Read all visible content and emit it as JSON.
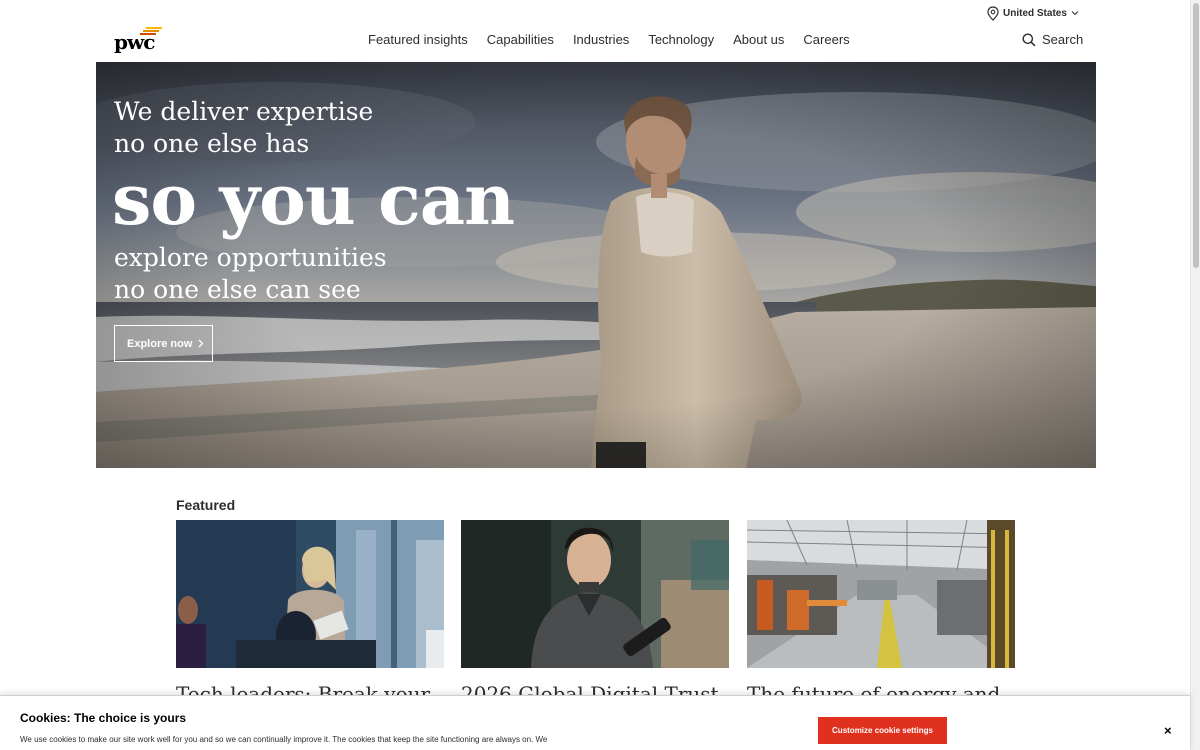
{
  "header": {
    "logo_text": "pwc",
    "locale": "United States",
    "nav": [
      "Featured insights",
      "Capabilities",
      "Industries",
      "Technology",
      "About us",
      "Careers"
    ],
    "search_label": "Search"
  },
  "hero": {
    "line1": "We deliver expertise",
    "line2": "no one else has",
    "big": "so you can",
    "line3": "explore opportunities",
    "line4": "no one else can see",
    "cta": "Explore now"
  },
  "featured": {
    "heading": "Featured",
    "cards": [
      {
        "title": "Tech leaders: Break your"
      },
      {
        "title": "2026 Global Digital Trust"
      },
      {
        "title": "The future of energy and"
      }
    ]
  },
  "cookie": {
    "title": "Cookies: The choice is yours",
    "text": "We use cookies to make our site work well for you and so we can continually improve it. The cookies that keep the site functioning are always on. We",
    "button": "Customize cookie settings",
    "close": "×"
  },
  "colors": {
    "brand_orange": "#e0301e",
    "logo_bar_1": "#ffb600",
    "logo_bar_2": "#eb8c00",
    "logo_bar_3": "#d04a02"
  }
}
